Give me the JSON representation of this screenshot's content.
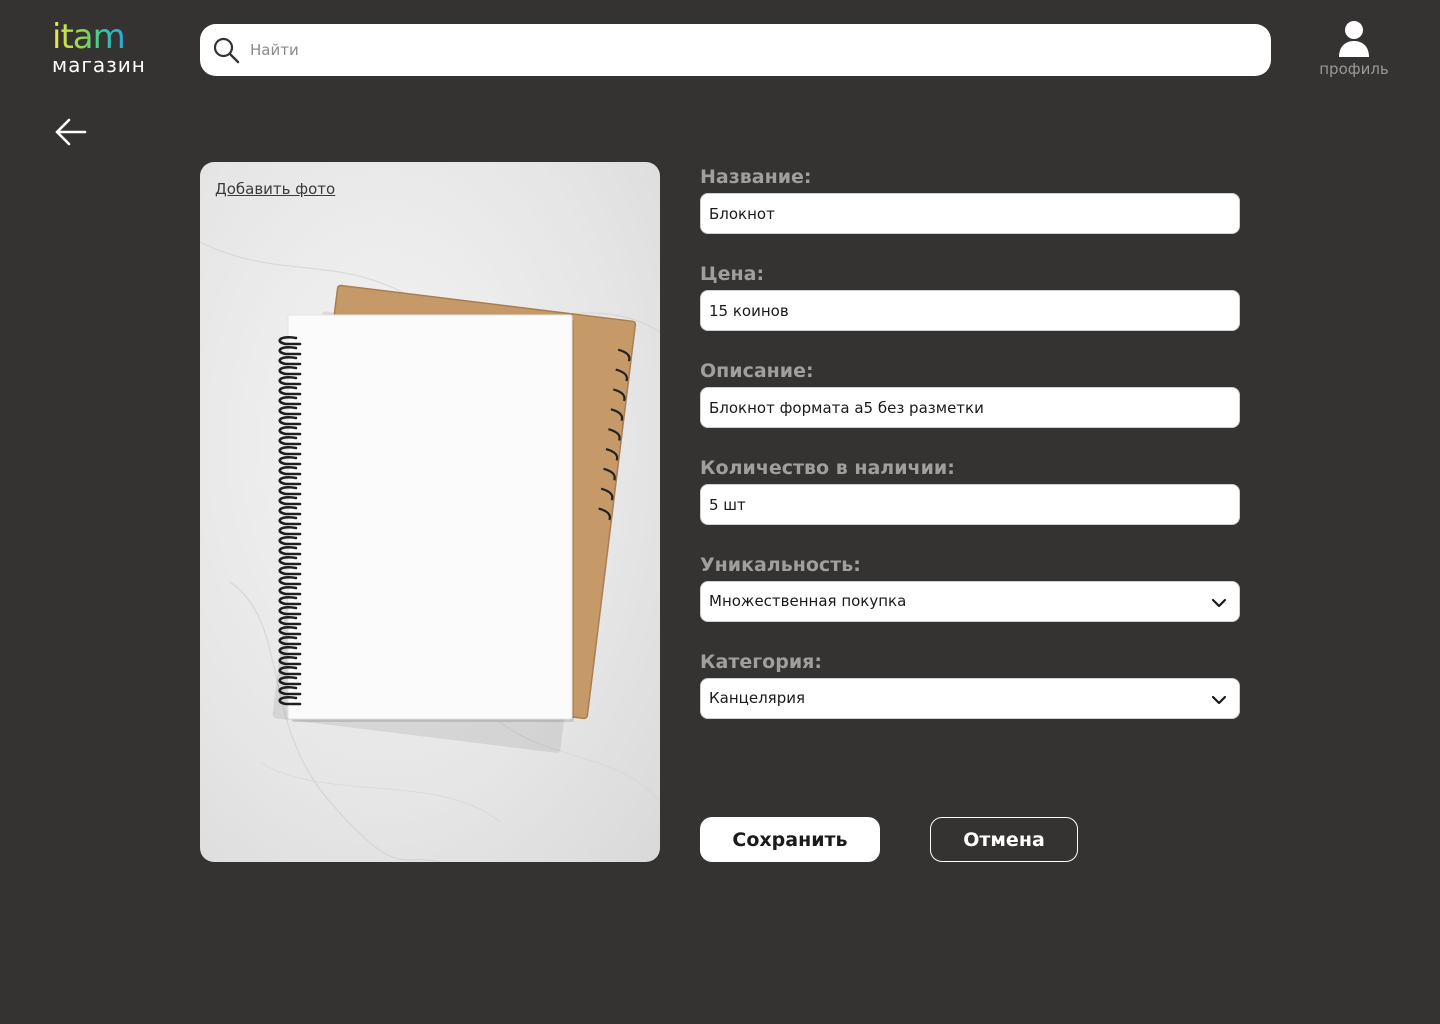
{
  "header": {
    "logo_main": "itam",
    "logo_sub": "магазин",
    "search_placeholder": "Найти",
    "profile_label": "профиль"
  },
  "photo": {
    "add_photo_label": "Добавить фото"
  },
  "form": {
    "name_label": "Название:",
    "name_value": "Блокнот",
    "price_label": "Цена:",
    "price_value": "15 коинов",
    "description_label": "Описание:",
    "description_value": "Блокнот формата а5 без разметки",
    "quantity_label": "Количество в наличии:",
    "quantity_value": "5 шт",
    "uniqueness_label": "Уникальность:",
    "uniqueness_value": "Множественная покупка",
    "category_label": "Категория:",
    "category_value": "Канцелярия"
  },
  "actions": {
    "save_label": "Сохранить",
    "cancel_label": "Отмена"
  },
  "icons": {
    "search": "search-icon",
    "profile": "user-icon",
    "back": "arrow-left-icon",
    "dropdown": "chevron-down-icon"
  },
  "colors": {
    "background": "#353332",
    "label": "#a19e9b",
    "surface": "#ffffff"
  }
}
